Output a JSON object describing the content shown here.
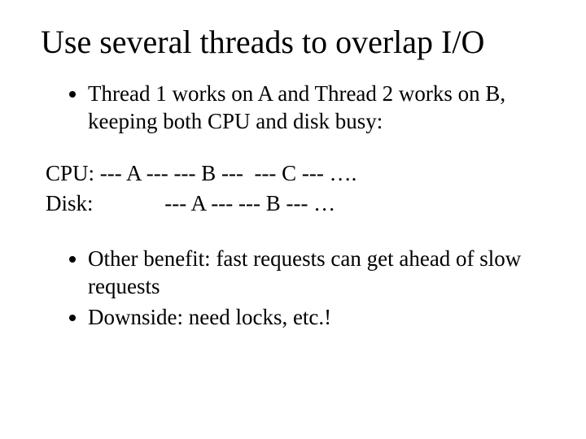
{
  "title": "Use several threads to overlap I/O",
  "bullets_top": [
    "Thread 1 works on A and Thread 2 works on B, keeping both CPU and disk busy:"
  ],
  "timeline": {
    "cpu": "CPU: --- A --- --- B ---  --- C --- ….",
    "disk": "Disk:             --- A --- --- B --- …"
  },
  "bullets_bottom": [
    "Other benefit: fast requests can get ahead of slow requests",
    "Downside: need locks, etc.!"
  ]
}
